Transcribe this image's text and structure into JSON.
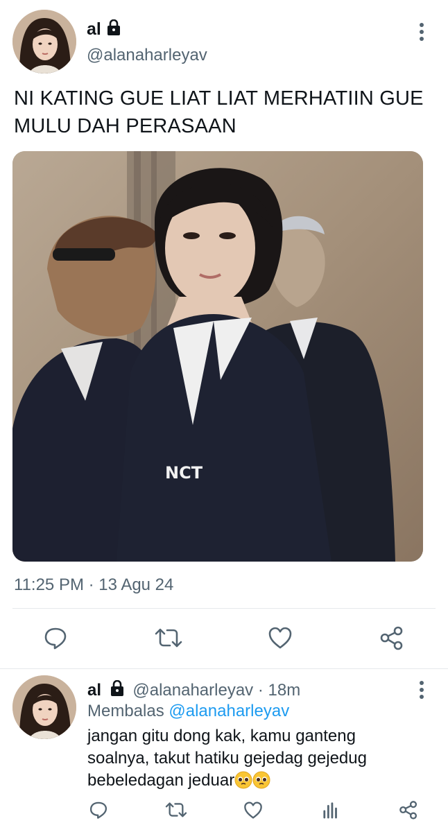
{
  "main_tweet": {
    "display_name": "al",
    "handle": "@alanaharleyav",
    "text_line1": "NI KATING GUE LIAT LIAT MERHATIIN GUE",
    "text_line2": "MULU DAH PERASAAN",
    "timestamp": "11:25 PM · 13 Agu 24",
    "media_badge_text": "NCT",
    "actions": [
      "reply-icon",
      "retweet-icon",
      "like-icon",
      "share-icon"
    ]
  },
  "reply": {
    "display_name": "al",
    "handle": "@alanaharleyav",
    "separator": "·",
    "time": "18m",
    "replying_label": "Membalas",
    "replying_to": "@alanaharleyav",
    "text_line1": "jangan gitu dong kak, kamu ganteng",
    "text_line2": "soalnya, takut hatiku gejedag gejedug",
    "text_line3": "bebeledagan jeduar",
    "emojis": [
      "pleading-face",
      "pleading-face"
    ],
    "actions": [
      "reply-icon",
      "retweet-icon",
      "like-icon",
      "analytics-icon",
      "share-icon"
    ]
  },
  "colors": {
    "text": "#0f1419",
    "muted": "#536471",
    "link": "#1d9bf0",
    "divider": "#e6e9ec"
  }
}
